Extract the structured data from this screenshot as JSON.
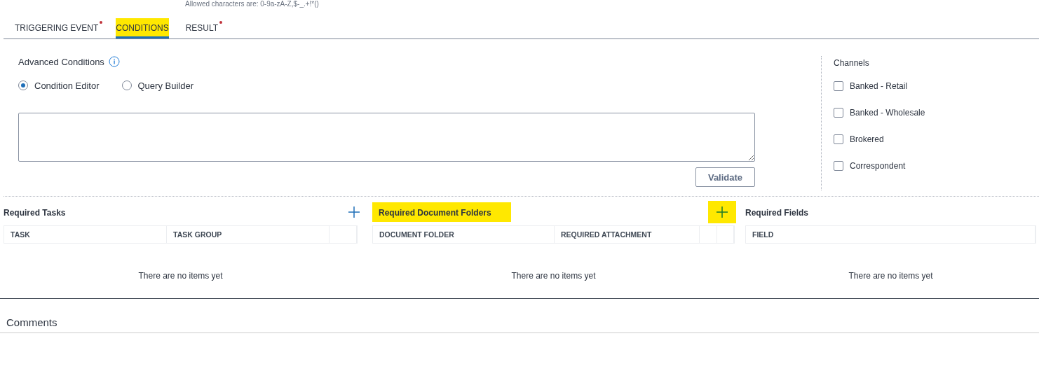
{
  "hint": "Allowed characters are: 0-9a-zA-Z,$-_.+!*()",
  "tabs": [
    {
      "label": "TRIGGERING EVENT",
      "selected": false,
      "required": true,
      "highlighted": false
    },
    {
      "label": "CONDITIONS",
      "selected": true,
      "required": false,
      "highlighted": true
    },
    {
      "label": "RESULT",
      "selected": false,
      "required": true,
      "highlighted": false
    }
  ],
  "advanced_conditions": {
    "label": "Advanced Conditions",
    "options": [
      {
        "label": "Condition Editor",
        "selected": true
      },
      {
        "label": "Query Builder",
        "selected": false
      }
    ],
    "validate_button": "Validate"
  },
  "channels": {
    "title": "Channels",
    "items": [
      {
        "label": "Banked - Retail",
        "checked": false
      },
      {
        "label": "Banked - Wholesale",
        "checked": false
      },
      {
        "label": "Brokered",
        "checked": false
      },
      {
        "label": "Correspondent",
        "checked": false
      }
    ]
  },
  "panels": [
    {
      "title": "Required Tasks",
      "title_highlighted": false,
      "add": {
        "highlighted": false
      },
      "columns": [
        "TASK",
        "TASK GROUP",
        ""
      ],
      "empty": "There are no items yet"
    },
    {
      "title": "Required Document Folders",
      "title_highlighted": true,
      "add": {
        "highlighted": true
      },
      "columns": [
        "DOCUMENT FOLDER",
        "REQUIRED ATTACHMENT",
        "",
        ""
      ],
      "empty": "There are no items yet"
    },
    {
      "title": "Required Fields",
      "title_highlighted": false,
      "columns": [
        "FIELD"
      ],
      "empty": "There are no items yet"
    }
  ],
  "comments": {
    "title": "Comments"
  }
}
